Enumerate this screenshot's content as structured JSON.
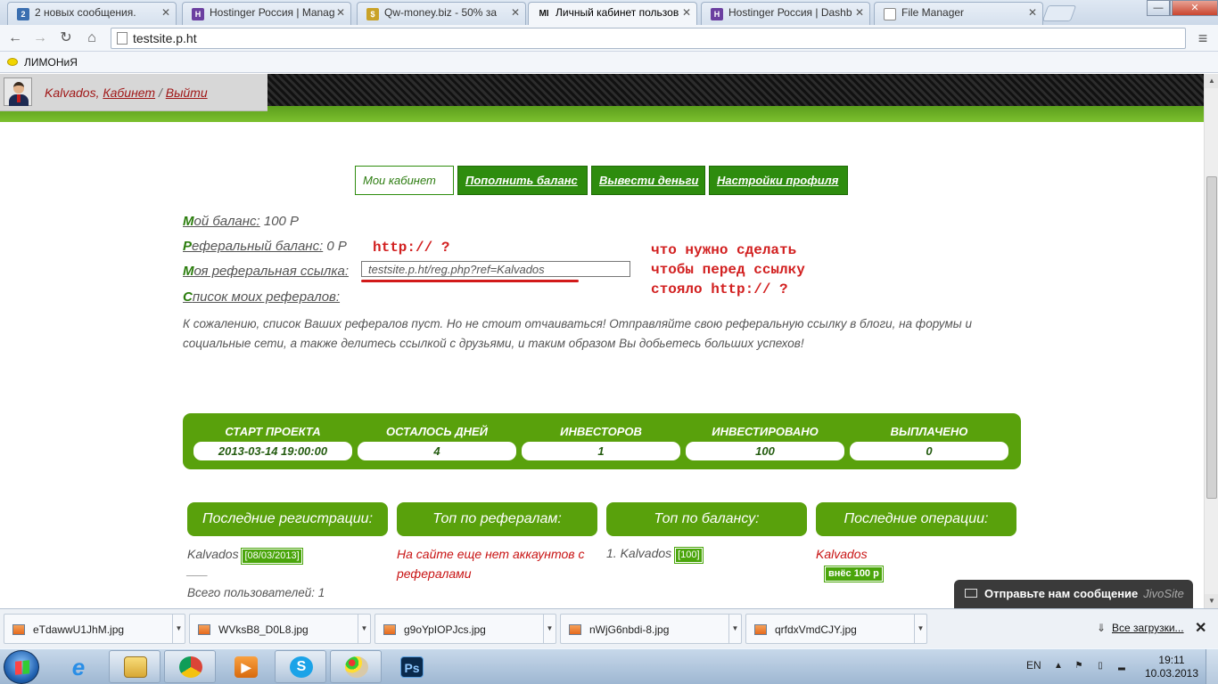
{
  "browser": {
    "tabs": [
      {
        "title": "2 новых сообщения.",
        "active": false
      },
      {
        "title": "Hostinger Россия | Manag",
        "active": false
      },
      {
        "title": "Qw-money.biz - 50% за",
        "active": false
      },
      {
        "title": "Личный кабинет пользов",
        "active": true
      },
      {
        "title": "Hostinger Россия | Dashb",
        "active": false
      },
      {
        "title": "File Manager",
        "active": false
      }
    ],
    "url": "testsite.p.ht",
    "bookmark": "ЛИМОНиЯ"
  },
  "user": {
    "name": "Kalvados",
    "cabinet": "Кабинет",
    "logout": "Выйти",
    "separator": "/"
  },
  "menu": [
    {
      "label": "Мои кабинет",
      "active": true
    },
    {
      "label": "Пополнить баланс",
      "active": false
    },
    {
      "label": "Вывести деньги",
      "active": false
    },
    {
      "label": "Настройки профиля",
      "active": false
    }
  ],
  "account": {
    "balance_label_initial": "М",
    "balance_label_rest": "ой баланс:",
    "balance_value": "100 Р",
    "ref_balance_label_initial": "Р",
    "ref_balance_label_rest": "еферальный баланс:",
    "ref_balance_value": "0 Р",
    "ref_link_label_initial": "М",
    "ref_link_label_rest": "оя реферальная ссылка:",
    "ref_link_value": "testsite.p.ht/reg.php?ref=Kalvados",
    "referrals_label_initial": "С",
    "referrals_label_rest": "писок моих рефералов:",
    "empty_message": "К сожалению, список Ваших рефералов пуст. Но не стоит отчаиваться! Отправляйте свою реферальную ссылку в блоги, на форумы и социальные сети, а также делитесь ссылкой с друзьями, и таким образом Вы добьетесь больших успехов!"
  },
  "annotations": {
    "http_question": "http:// ?",
    "line1": "что нужно сделать",
    "line2": "чтобы перед ссылку",
    "line3": "стояло http:// ?"
  },
  "stats": [
    {
      "label": "СТАРТ ПРОЕКТА",
      "value": "2013-03-14 19:00:00"
    },
    {
      "label": "ОСТАЛОСЬ ДНЕЙ",
      "value": "4"
    },
    {
      "label": "ИНВЕСТОРОВ",
      "value": "1"
    },
    {
      "label": "ИНВЕСТИРОВАНО",
      "value": "100"
    },
    {
      "label": "ВЫПЛАЧЕНО",
      "value": "0"
    }
  ],
  "columns": {
    "registrations": {
      "title": "Последние регистрации:",
      "name": "Kalvados",
      "date": "[08/03/2013]",
      "dash": "___",
      "total": "Всего пользователей: 1"
    },
    "top_referrals": {
      "title": "Топ по рефералам:",
      "empty": "На сайте еще нет аккаунтов с рефералами"
    },
    "top_balance": {
      "title": "Топ по балансу:",
      "entry": "1. Kalvados",
      "amount": "[100]"
    },
    "operations": {
      "title": "Последние операции:",
      "name": "Kalvados",
      "op": "внёс 100 р"
    }
  },
  "jivo": {
    "text": "Отправьте нам сообщение",
    "brand": "JivoSite"
  },
  "downloads": {
    "items": [
      "eTdawwU1JhM.jpg",
      "WVksB8_D0L8.jpg",
      "g9oYpIOPJcs.jpg",
      "nWjG6nbdi-8.jpg",
      "qrfdxVmdCJY.jpg"
    ],
    "all_label": "Все загрузки..."
  },
  "taskbar": {
    "lang": "EN",
    "time": "19:11",
    "date": "10.03.2013",
    "photoshop_label": "Ps"
  },
  "colors": {
    "green": "#59a10c",
    "dark_green": "#2e8c0e",
    "annotation_red": "#d22020"
  }
}
